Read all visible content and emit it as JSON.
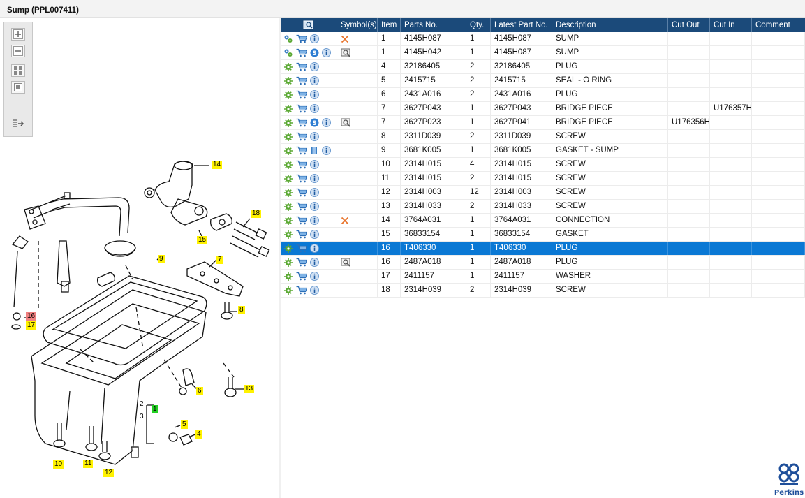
{
  "window": {
    "title": "Sump (PPL007411)"
  },
  "toolbar": {
    "tools": [
      "zoom-in-icon",
      "zoom-out-icon",
      "fit-all-icon",
      "fit-page-icon",
      "export-list-icon"
    ]
  },
  "table": {
    "columns": [
      "Symbol(s)",
      "Item",
      "Parts No.",
      "Qty.",
      "Latest Part No.",
      "Description",
      "Cut Out",
      "Cut In",
      "Comment"
    ],
    "rows": [
      {
        "item": "1",
        "part": "4145H087",
        "qty": "1",
        "latest": "4145H087",
        "desc": "SUMP",
        "cutout": "",
        "cutin": "",
        "comment": "",
        "cart": "multi",
        "s": false,
        "book": false,
        "sym": "x"
      },
      {
        "item": "1",
        "part": "4145H042",
        "qty": "1",
        "latest": "4145H087",
        "desc": "SUMP",
        "cutout": "",
        "cutin": "",
        "comment": "",
        "cart": "multi",
        "s": true,
        "book": false,
        "sym": "view"
      },
      {
        "item": "4",
        "part": "32186405",
        "qty": "2",
        "latest": "32186405",
        "desc": "PLUG",
        "cutout": "",
        "cutin": "",
        "comment": "",
        "cart": "single",
        "s": false,
        "book": false,
        "sym": ""
      },
      {
        "item": "5",
        "part": "2415715",
        "qty": "2",
        "latest": "2415715",
        "desc": "SEAL - O RING",
        "cutout": "",
        "cutin": "",
        "comment": "",
        "cart": "single",
        "s": false,
        "book": false,
        "sym": ""
      },
      {
        "item": "6",
        "part": "2431A016",
        "qty": "2",
        "latest": "2431A016",
        "desc": "PLUG",
        "cutout": "",
        "cutin": "",
        "comment": "",
        "cart": "single",
        "s": false,
        "book": false,
        "sym": ""
      },
      {
        "item": "7",
        "part": "3627P043",
        "qty": "1",
        "latest": "3627P043",
        "desc": "BRIDGE PIECE",
        "cutout": "",
        "cutin": "U176357H",
        "comment": "",
        "cart": "single",
        "s": false,
        "book": false,
        "sym": ""
      },
      {
        "item": "7",
        "part": "3627P023",
        "qty": "1",
        "latest": "3627P041",
        "desc": "BRIDGE PIECE",
        "cutout": "U176356H",
        "cutin": "",
        "comment": "",
        "cart": "single",
        "s": true,
        "book": false,
        "sym": "view"
      },
      {
        "item": "8",
        "part": "2311D039",
        "qty": "2",
        "latest": "2311D039",
        "desc": "SCREW",
        "cutout": "",
        "cutin": "",
        "comment": "",
        "cart": "single",
        "s": false,
        "book": false,
        "sym": ""
      },
      {
        "item": "9",
        "part": "3681K005",
        "qty": "1",
        "latest": "3681K005",
        "desc": "GASKET - SUMP",
        "cutout": "",
        "cutin": "",
        "comment": "",
        "cart": "single",
        "s": false,
        "book": true,
        "sym": ""
      },
      {
        "item": "10",
        "part": "2314H015",
        "qty": "4",
        "latest": "2314H015",
        "desc": "SCREW",
        "cutout": "",
        "cutin": "",
        "comment": "",
        "cart": "single",
        "s": false,
        "book": false,
        "sym": ""
      },
      {
        "item": "11",
        "part": "2314H015",
        "qty": "2",
        "latest": "2314H015",
        "desc": "SCREW",
        "cutout": "",
        "cutin": "",
        "comment": "",
        "cart": "single",
        "s": false,
        "book": false,
        "sym": ""
      },
      {
        "item": "12",
        "part": "2314H003",
        "qty": "12",
        "latest": "2314H003",
        "desc": "SCREW",
        "cutout": "",
        "cutin": "",
        "comment": "",
        "cart": "single",
        "s": false,
        "book": false,
        "sym": ""
      },
      {
        "item": "13",
        "part": "2314H033",
        "qty": "2",
        "latest": "2314H033",
        "desc": "SCREW",
        "cutout": "",
        "cutin": "",
        "comment": "",
        "cart": "single",
        "s": false,
        "book": false,
        "sym": ""
      },
      {
        "item": "14",
        "part": "3764A031",
        "qty": "1",
        "latest": "3764A031",
        "desc": "CONNECTION",
        "cutout": "",
        "cutin": "",
        "comment": "",
        "cart": "single",
        "s": false,
        "book": false,
        "sym": "x"
      },
      {
        "item": "15",
        "part": "36833154",
        "qty": "1",
        "latest": "36833154",
        "desc": "GASKET",
        "cutout": "",
        "cutin": "",
        "comment": "",
        "cart": "single",
        "s": false,
        "book": false,
        "sym": ""
      },
      {
        "item": "16",
        "part": "T406330",
        "qty": "1",
        "latest": "T406330",
        "desc": "PLUG",
        "cutout": "",
        "cutin": "",
        "comment": "",
        "cart": "single",
        "s": false,
        "book": false,
        "sym": "",
        "selected": true
      },
      {
        "item": "16",
        "part": "2487A018",
        "qty": "1",
        "latest": "2487A018",
        "desc": "PLUG",
        "cutout": "",
        "cutin": "",
        "comment": "",
        "cart": "single",
        "s": false,
        "book": false,
        "sym": "view"
      },
      {
        "item": "17",
        "part": "2411157",
        "qty": "1",
        "latest": "2411157",
        "desc": "WASHER",
        "cutout": "",
        "cutin": "",
        "comment": "",
        "cart": "single",
        "s": false,
        "book": false,
        "sym": ""
      },
      {
        "item": "18",
        "part": "2314H039",
        "qty": "2",
        "latest": "2314H039",
        "desc": "SCREW",
        "cutout": "",
        "cutin": "",
        "comment": "",
        "cart": "single",
        "s": false,
        "book": false,
        "sym": ""
      }
    ]
  },
  "diagram": {
    "callouts": [
      "14",
      "18",
      "15",
      "9",
      "7",
      "8",
      "16",
      "17",
      "6",
      "13",
      "1",
      "2",
      "3",
      "5",
      "4",
      "10",
      "11",
      "12"
    ],
    "selected_callout": "16",
    "highlight_green": "1"
  },
  "brand": {
    "name": "Perkins",
    "color": "#1f4f9a"
  },
  "colors": {
    "header": "#1b4a7a",
    "selection": "#0a78d4",
    "callout": "#fff200",
    "callout_selected": "#f08080",
    "callout_active": "#22d022"
  }
}
